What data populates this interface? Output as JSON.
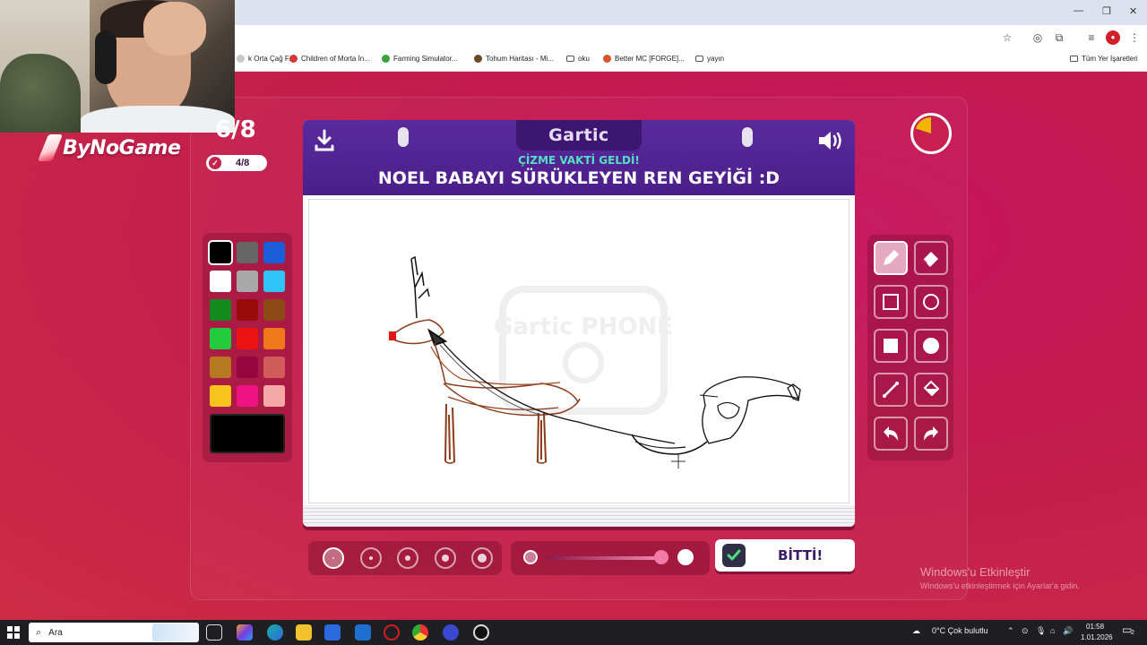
{
  "browser": {
    "bookmarks": [
      {
        "label": "k Orta Çağ F...",
        "color": "#c8c8c8"
      },
      {
        "label": "Children of Morta İn...",
        "color": "#d03a3a"
      },
      {
        "label": "Farming Simulator...",
        "color": "#3aa23a"
      },
      {
        "label": "Tohum Haritası - Mi...",
        "color": "#6b4a2a"
      },
      {
        "label": "oku",
        "color": "folder"
      },
      {
        "label": "Better MC [FORGE]...",
        "color": "#d8552a"
      },
      {
        "label": "yayın",
        "color": "folder"
      }
    ],
    "all_bookmarks_label": "Tüm Yer İşaretleri"
  },
  "stream": {
    "brand": "ByNoGame",
    "round": "6/8",
    "progress": "4/8"
  },
  "game": {
    "logo": "Gartic",
    "subtitle": "ÇİZME VAKTİ GELDİ!",
    "prompt": "NOEL BABAYI SÜRÜKLEYEN REN GEYİĞİ :D",
    "watermark": "Gartic PHONE",
    "done_label": "BİTTİ!",
    "timer_elapsed_fraction": 0.2,
    "opacity_level": 1.0,
    "selected_brush_index": 0
  },
  "palette": {
    "colors": [
      "#000000",
      "#666666",
      "#1a5fd9",
      "#ffffff",
      "#a9a9a9",
      "#2ec4f6",
      "#138a1f",
      "#9a0a0a",
      "#8b4a16",
      "#22cc3c",
      "#ec1313",
      "#f0781a",
      "#b7791f",
      "#97073e",
      "#d25b5b",
      "#f8c21f",
      "#f01183",
      "#f7a7a7"
    ],
    "selected": "#000000"
  },
  "colors": {
    "accent": "#c8224e",
    "notebook_header": "#4b1f8a",
    "subtitle": "#53e0c4",
    "timer_fill": "#f2b600"
  },
  "tools": [
    "pencil-tool",
    "eraser-tool",
    "rectangle-outline-tool",
    "circle-outline-tool",
    "rectangle-fill-tool",
    "circle-fill-tool",
    "line-tool",
    "fill-bucket-tool",
    "undo-tool",
    "redo-tool"
  ],
  "windows": {
    "activation_title": "Windows'u Etkinleştir",
    "activation_sub": "Windows'u etkinleştirmek için Ayarlar'a gidin."
  },
  "taskbar": {
    "search_placeholder": "Ara",
    "weather": "0°C  Çok bulutlu",
    "time": "01:58",
    "date": "1.01.2026",
    "notification_count": "2"
  }
}
